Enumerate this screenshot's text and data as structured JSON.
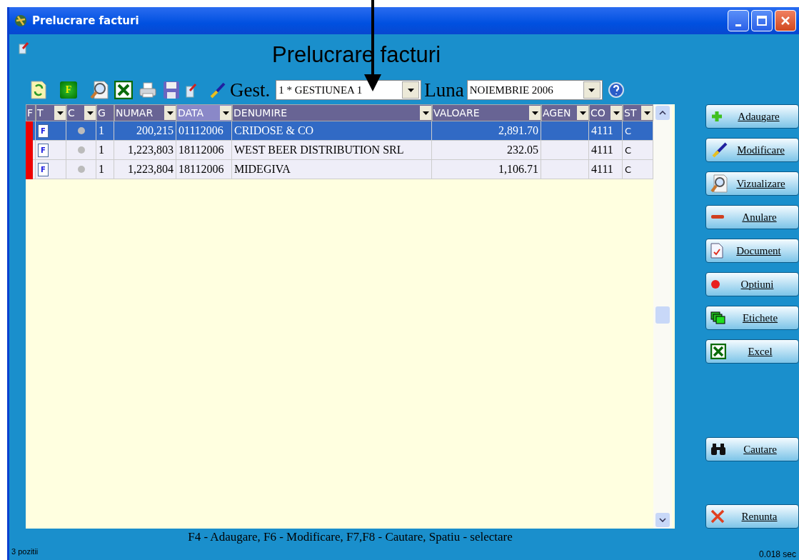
{
  "window": {
    "title": "Prelucrare facturi"
  },
  "heading": "Prelucrare facturi",
  "toolbar": {
    "f_label": "F",
    "gest_label": "Gest.",
    "gest_value": "1 * GESTIUNEA 1",
    "luna_label": "Luna",
    "luna_value": "NOIEMBRIE 2006"
  },
  "table": {
    "columns": [
      {
        "label": "F",
        "filter": false,
        "sorted": false
      },
      {
        "label": "T",
        "filter": true,
        "sorted": false
      },
      {
        "label": "C",
        "filter": true,
        "sorted": false
      },
      {
        "label": "G",
        "filter": false,
        "sorted": false
      },
      {
        "label": "NUMAR",
        "filter": true,
        "sorted": false
      },
      {
        "label": "DATA",
        "filter": true,
        "sorted": true
      },
      {
        "label": "DENUMIRE",
        "filter": true,
        "sorted": false
      },
      {
        "label": "VALOARE",
        "filter": true,
        "sorted": false
      },
      {
        "label": "AGEN",
        "filter": true,
        "sorted": false
      },
      {
        "label": "CO",
        "filter": true,
        "sorted": false
      },
      {
        "label": "ST",
        "filter": true,
        "sorted": false
      }
    ],
    "rows": [
      {
        "selected": true,
        "color": "#ee0000",
        "type_letter": "F",
        "g": "1",
        "numar": "200,215",
        "data": "01112006",
        "denumire": "CRIDOSE & CO",
        "valoare": "2,891.70",
        "co": "4111",
        "st": "C"
      },
      {
        "selected": false,
        "color": "#ee0000",
        "type_letter": "F",
        "g": "1",
        "numar": "1,223,803",
        "data": "18112006",
        "denumire": "WEST BEER DISTRIBUTION SRL",
        "valoare": "232.05",
        "co": "4111",
        "st": "C"
      },
      {
        "selected": false,
        "color": "#ee0000",
        "type_letter": "F",
        "g": "1",
        "numar": "1,223,804",
        "data": "18112006",
        "denumire": "MIDEGIVA",
        "valoare": "1,106.71",
        "co": "4111",
        "st": "C"
      }
    ]
  },
  "buttons": [
    {
      "kind": "plus",
      "label": "Adaugare"
    },
    {
      "kind": "pen",
      "label": "Modificare"
    },
    {
      "kind": "magnifier",
      "label": "Vizualizare"
    },
    {
      "kind": "minus",
      "label": "Anulare"
    },
    {
      "kind": "document",
      "label": "Document"
    },
    {
      "kind": "dot",
      "label": "Optiuni"
    },
    {
      "kind": "labels",
      "label": "Etichete"
    },
    {
      "kind": "excel",
      "label": "Excel"
    },
    {
      "kind": "binoculars",
      "label": "Cautare"
    },
    {
      "kind": "cross",
      "label": "Renunta"
    }
  ],
  "hint": "F4 - Adaugare, F6 - Modificare, F7,F8 - Cautare, Spatiu - selectare",
  "status_bar": {
    "count": "3 pozitii",
    "time": "0.018 sec"
  }
}
